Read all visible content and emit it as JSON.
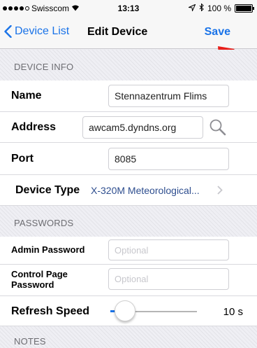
{
  "status_bar": {
    "carrier": "Swisscom",
    "time": "13:13",
    "battery": "100 %",
    "battery_level": 1.0
  },
  "nav": {
    "back_label": "Device List",
    "title": "Edit Device",
    "save_label": "Save"
  },
  "device_info": {
    "header": "DEVICE INFO",
    "name_label": "Name",
    "name_value": "Stennazentrum Flims",
    "address_label": "Address",
    "address_value": "awcam5.dyndns.org",
    "port_label": "Port",
    "port_value": "8085",
    "device_type_label": "Device Type",
    "device_type_value": "X-320M Meteorological..."
  },
  "passwords": {
    "header": "PASSWORDS",
    "admin_label": "Admin Password",
    "admin_placeholder": "Optional",
    "control_label_line1": "Control Page",
    "control_label_line2": "Password",
    "control_placeholder": "Optional"
  },
  "refresh": {
    "label": "Refresh Speed",
    "value": "10 s",
    "slider_fraction": 0.17
  },
  "notes": {
    "header": "NOTES"
  },
  "colors": {
    "accent": "#1a73e8",
    "arrow": "#e8201b"
  }
}
